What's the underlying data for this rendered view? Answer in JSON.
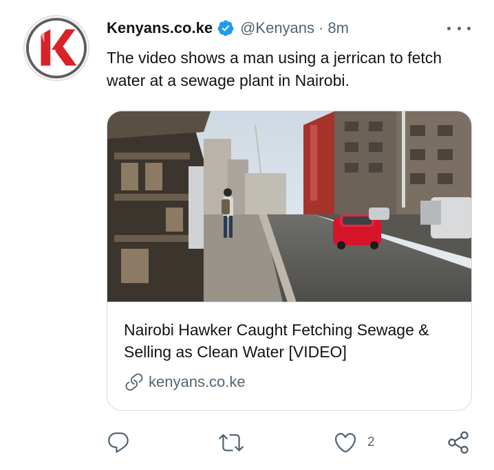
{
  "tweet": {
    "author_name": "Kenyans.co.ke",
    "handle": "@Kenyans",
    "separator": "·",
    "time": "8m",
    "text": "The video shows a man using a jerrican to fetch water at a sewage plant in Nairobi.",
    "verified": true
  },
  "card": {
    "title": "Nairobi Hawker Caught Fetching Sewage & Selling as Clean Water [VIDEO]",
    "domain": "kenyans.co.ke"
  },
  "actions": {
    "reply_count": "",
    "retweet_count": "",
    "like_count": "2"
  },
  "colors": {
    "accent": "#1d9bf0",
    "secondary_text": "#536471",
    "border": "#cfd9de",
    "logo_red": "#d92128"
  },
  "icons": {
    "more": "more-horizontal-icon",
    "verified": "verified-badge-icon",
    "link": "link-icon",
    "reply": "reply-icon",
    "retweet": "retweet-icon",
    "like": "heart-icon",
    "share": "share-icon"
  }
}
